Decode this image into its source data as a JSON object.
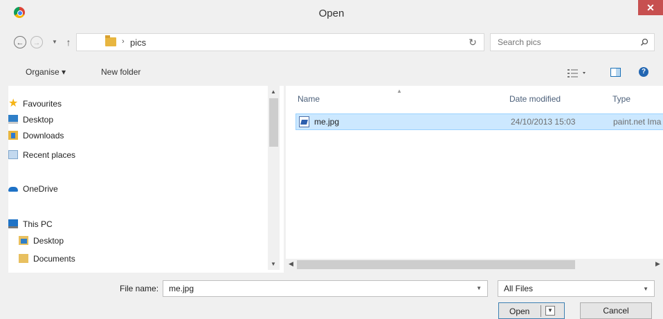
{
  "window": {
    "title": "Open",
    "close_glyph": "✕",
    "app_icon": "chrome-icon"
  },
  "address": {
    "back_glyph": "←",
    "forward_glyph": "→",
    "recent_glyph": "▼",
    "up_glyph": "↑",
    "separator": "›",
    "crumb": "pics",
    "dropdown_glyph": "⌄",
    "refresh_glyph": "↻"
  },
  "search": {
    "placeholder": "Search pics"
  },
  "toolbar": {
    "organise_label": "Organise ▾",
    "new_folder_label": "New folder",
    "help_glyph": "?"
  },
  "nav": {
    "items": [
      {
        "label": "Favourites",
        "icon": "star-icon"
      },
      {
        "label": "Desktop",
        "icon": "desktop-icon"
      },
      {
        "label": "Downloads",
        "icon": "downloads-icon"
      },
      {
        "label": "Recent places",
        "icon": "recent-places-icon"
      },
      {
        "label": "OneDrive",
        "icon": "onedrive-icon"
      },
      {
        "label": "This PC",
        "icon": "this-pc-icon"
      },
      {
        "label": "Desktop",
        "icon": "desktop-folder-icon"
      },
      {
        "label": "Documents",
        "icon": "documents-folder-icon"
      }
    ]
  },
  "files": {
    "columns": [
      "Name",
      "Date modified",
      "Type"
    ],
    "rows": [
      {
        "name": "me.jpg",
        "date_modified": "24/10/2013 15:03",
        "type": "paint.net Ima",
        "selected": true
      }
    ]
  },
  "bottom": {
    "file_name_label": "File name:",
    "file_name_value": "me.jpg",
    "file_type_value": "All Files",
    "open_label": "Open",
    "cancel_label": "Cancel"
  },
  "colors": {
    "selection_bg": "#cce8ff",
    "selection_border": "#99d1ff",
    "close_red": "#c75050",
    "accent_blue": "#3c7fb1"
  }
}
